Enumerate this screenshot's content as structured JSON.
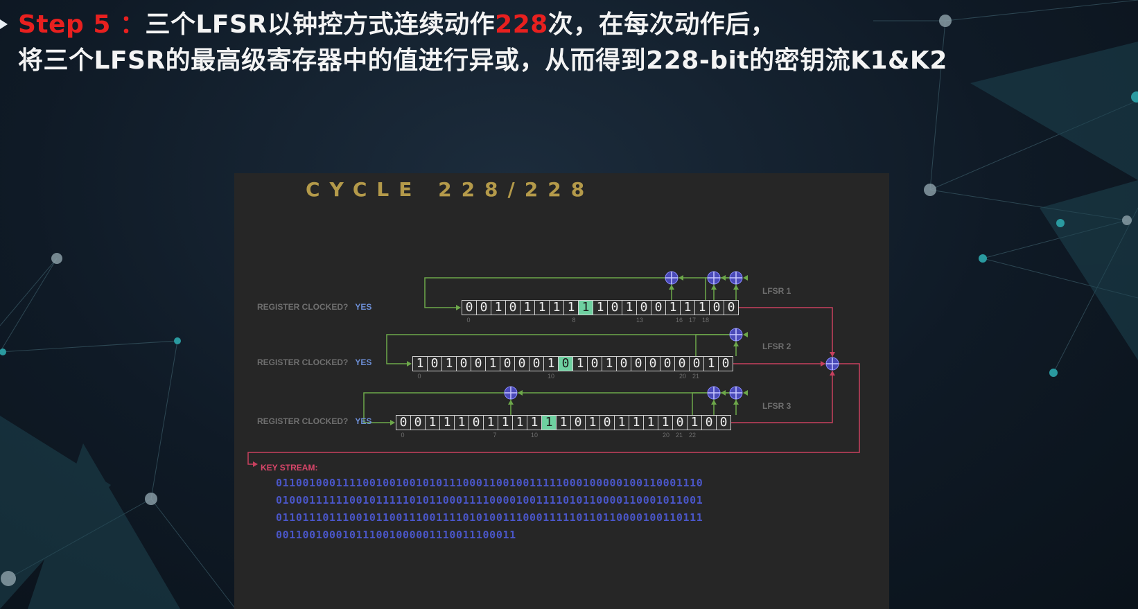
{
  "heading": {
    "step": "Step 5",
    "colon": " ：",
    "line1_a": "三个LFSR以钟控方式连续动作",
    "line1_num": "228",
    "line1_b": "次，在每次动作后，",
    "line2": "将三个LFSR的最高级寄存器中的值进行异或，从而得到228-bit的密钥流K1&K2"
  },
  "colors": {
    "accent_red": "#e8201f",
    "register_highlight": "#6ed0a0",
    "feedback_wire": "#6da84a",
    "output_wire": "#c8405e",
    "xor_node": "#4a4ab8",
    "keystream_text": "#4a56c8",
    "cycle_text": "#b49a4a"
  },
  "cycle": {
    "label": "CYCLE 228/228",
    "current": 228,
    "total": 228
  },
  "clock_label": "REGISTER CLOCKED?",
  "clock_value": "YES",
  "lfsrs": [
    {
      "name": "LFSR 1",
      "bits": [
        "0",
        "0",
        "1",
        "0",
        "1",
        "1",
        "1",
        "1",
        "1",
        "1",
        "0",
        "1",
        "0",
        "0",
        "1",
        "1",
        "1",
        "0",
        "0"
      ],
      "highlight": 8,
      "tick_labels": [
        "0",
        "8",
        "13",
        "16",
        "17",
        "18"
      ]
    },
    {
      "name": "LFSR 2",
      "bits": [
        "1",
        "0",
        "1",
        "0",
        "0",
        "1",
        "0",
        "0",
        "0",
        "1",
        "0",
        "1",
        "0",
        "1",
        "0",
        "0",
        "0",
        "0",
        "0",
        "0",
        "1",
        "0"
      ],
      "highlight": 10,
      "tick_labels": [
        "0",
        "10",
        "20",
        "21"
      ]
    },
    {
      "name": "LFSR 3",
      "bits": [
        "0",
        "0",
        "1",
        "1",
        "1",
        "0",
        "1",
        "1",
        "1",
        "1",
        "1",
        "1",
        "0",
        "1",
        "0",
        "1",
        "1",
        "1",
        "1",
        "0",
        "1",
        "0",
        "0"
      ],
      "highlight": 10,
      "tick_labels": [
        "0",
        "7",
        "10",
        "20",
        "21",
        "22"
      ]
    }
  ],
  "xor_symbol": "⊕",
  "keystream": {
    "label": "KEY STREAM:",
    "lines": [
      "0110010001111001001001010111000110010011111000100000100110001110",
      "0100011111100101111101011000111100001001111010110000110001011001",
      "0110111011100101100111001111010100111000111110110110000100110111",
      "001100100010111001000001110011100011"
    ]
  }
}
